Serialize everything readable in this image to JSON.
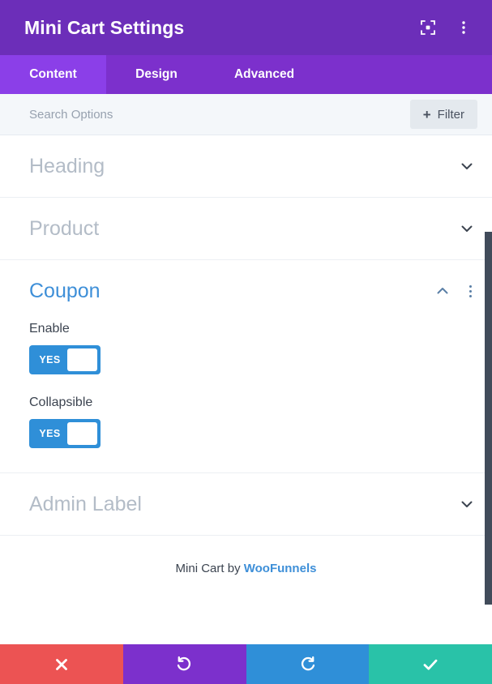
{
  "header": {
    "title": "Mini Cart Settings",
    "icons": [
      {
        "name": "focus-target-icon",
        "label": "Focus"
      },
      {
        "name": "vertical-dots-icon",
        "label": "More options"
      }
    ]
  },
  "tabs": [
    {
      "key": "content",
      "label": "Content",
      "active": true
    },
    {
      "key": "design",
      "label": "Design",
      "active": false
    },
    {
      "key": "advanced",
      "label": "Advanced",
      "active": false
    }
  ],
  "search": {
    "placeholder": "Search Options",
    "value": "",
    "filter_label": "Filter",
    "filter_plus": "+"
  },
  "sections": [
    {
      "key": "heading",
      "title": "Heading",
      "open": false,
      "chevron": "down"
    },
    {
      "key": "product",
      "title": "Product",
      "open": false,
      "chevron": "down"
    },
    {
      "key": "coupon",
      "title": "Coupon",
      "open": true,
      "chevron": "up"
    },
    {
      "key": "admin_label",
      "title": "Admin Label",
      "open": false,
      "chevron": "down"
    }
  ],
  "coupon_fields": [
    {
      "key": "enable",
      "label": "Enable",
      "toggle_value": "YES",
      "on": true
    },
    {
      "key": "collapsible",
      "label": "Collapsible",
      "toggle_value": "YES",
      "on": true
    }
  ],
  "credit": {
    "prefix": "Mini Cart by ",
    "link": "WooFunnels"
  },
  "actions": [
    {
      "key": "cancel",
      "icon": "close-icon",
      "color": "#EC5353"
    },
    {
      "key": "undo",
      "icon": "undo-icon",
      "color": "#7C30CC"
    },
    {
      "key": "redo",
      "icon": "redo-icon",
      "color": "#2F8FD8"
    },
    {
      "key": "save",
      "icon": "check-icon",
      "color": "#29C2A8"
    }
  ],
  "colors": {
    "header_purple": "#6C2EB9",
    "tabbar_purple": "#7C30CC",
    "tab_active_purple": "#8B3FE8",
    "accent_blue": "#3E8FD8",
    "toggle_blue": "#2F8FD8",
    "muted_title": "#b3bcc7",
    "search_bg": "#F4F7FA",
    "scrollbar": "#414B5A"
  }
}
